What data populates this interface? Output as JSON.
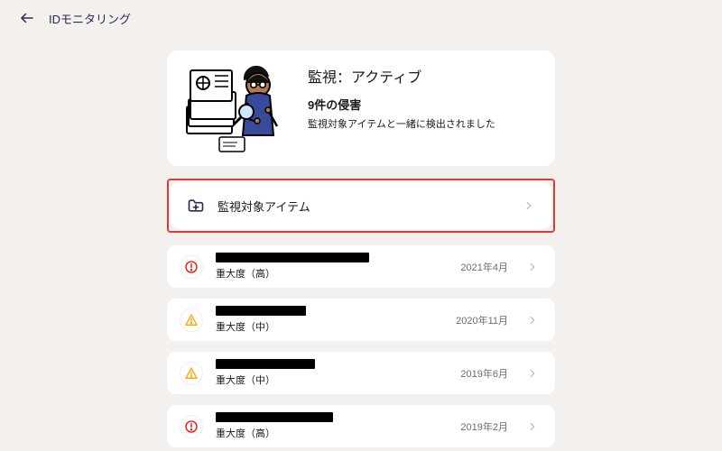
{
  "header": {
    "title": "IDモニタリング"
  },
  "status": {
    "heading": "監視：アクティブ",
    "breach_count_line": "9件の侵害",
    "desc": "監視対象アイテムと一緒に検出されました"
  },
  "monitored_items": {
    "label": "監視対象アイテム"
  },
  "breaches": [
    {
      "severity": "high",
      "severity_label": "重大度（高）",
      "date": "2021年4月"
    },
    {
      "severity": "med",
      "severity_label": "重大度（中）",
      "date": "2020年11月"
    },
    {
      "severity": "med",
      "severity_label": "重大度（中）",
      "date": "2019年6月"
    },
    {
      "severity": "high",
      "severity_label": "重大度（高）",
      "date": "2019年2月"
    }
  ],
  "icons": {
    "back": "arrow-left-icon",
    "folder": "folder-plus-icon",
    "chevron": "chevron-right-icon",
    "alert_high": "alert-circle-icon",
    "alert_med": "alert-triangle-icon"
  }
}
